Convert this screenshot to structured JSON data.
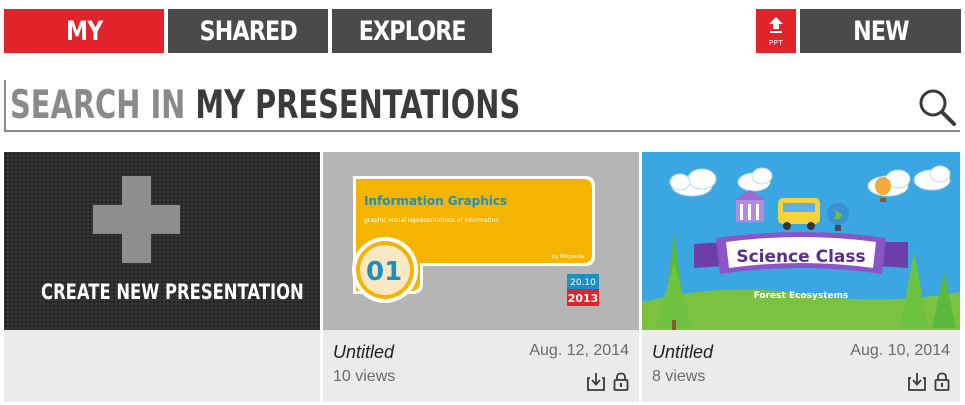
{
  "nav": {
    "tabs": [
      {
        "label": "MY",
        "active": true
      },
      {
        "label": "SHARED",
        "active": false
      },
      {
        "label": "EXPLORE",
        "active": false
      }
    ],
    "ppt_label": "PPT",
    "new_label": "NEW"
  },
  "search": {
    "prefix": "SEARCH IN",
    "scope": "MY PRESENTATIONS"
  },
  "create_card": {
    "label": "CREATE NEW PRESENTATION"
  },
  "presentations": [
    {
      "title": "Untitled",
      "date": "Aug. 12, 2014",
      "views": "10 views",
      "thumbnail": {
        "heading": "Information Graphics",
        "subheading": "graphic visual representations of information",
        "credit": "by Wikipedia",
        "number": "01",
        "date_top": "20.10",
        "date_bottom": "2013"
      }
    },
    {
      "title": "Untitled",
      "date": "Aug. 10, 2014",
      "views": "8 views",
      "thumbnail": {
        "heading": "Science Class",
        "subheading": "Forest Ecosystems"
      }
    }
  ],
  "colors": {
    "accent": "#e0242a",
    "tab_inactive": "#4a4a4a",
    "meta_bg": "#ebebeb"
  }
}
